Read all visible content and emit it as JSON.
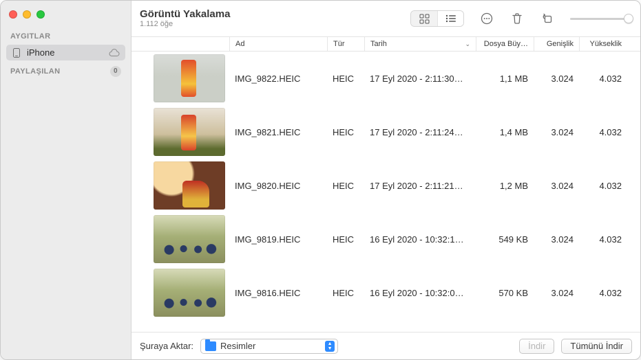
{
  "app": {
    "title": "Görüntü Yakalama",
    "item_count_label": "1.112 öğe"
  },
  "sidebar": {
    "sections": {
      "devices_label": "AYGITLAR",
      "shared_label": "PAYLAŞILAN",
      "shared_count": "0"
    },
    "items": [
      {
        "label": "iPhone"
      }
    ]
  },
  "columns": {
    "name": "Ad",
    "type": "Tür",
    "date": "Tarih",
    "size": "Dosya Büy…",
    "width": "Genişlik",
    "height": "Yükseklik"
  },
  "rows": [
    {
      "name": "IMG_9822.HEIC",
      "type": "HEIC",
      "date": "17 Eyl 2020 - 2:11:30…",
      "size": "1,1 MB",
      "width": "3.024",
      "height": "4.032",
      "thumb": "t1"
    },
    {
      "name": "IMG_9821.HEIC",
      "type": "HEIC",
      "date": "17 Eyl 2020 - 2:11:24…",
      "size": "1,4 MB",
      "width": "3.024",
      "height": "4.032",
      "thumb": "t2"
    },
    {
      "name": "IMG_9820.HEIC",
      "type": "HEIC",
      "date": "17 Eyl 2020 - 2:11:21…",
      "size": "1,2 MB",
      "width": "3.024",
      "height": "4.032",
      "thumb": "t3"
    },
    {
      "name": "IMG_9819.HEIC",
      "type": "HEIC",
      "date": "16 Eyl 2020 - 10:32:1…",
      "size": "549 KB",
      "width": "3.024",
      "height": "4.032",
      "thumb": "t4"
    },
    {
      "name": "IMG_9816.HEIC",
      "type": "HEIC",
      "date": "16 Eyl 2020 - 10:32:0…",
      "size": "570 KB",
      "width": "3.024",
      "height": "4.032",
      "thumb": "t5"
    }
  ],
  "footer": {
    "import_to_label": "Şuraya Aktar:",
    "destination": "Resimler",
    "download_label": "İndir",
    "download_all_label": "Tümünü İndir"
  }
}
